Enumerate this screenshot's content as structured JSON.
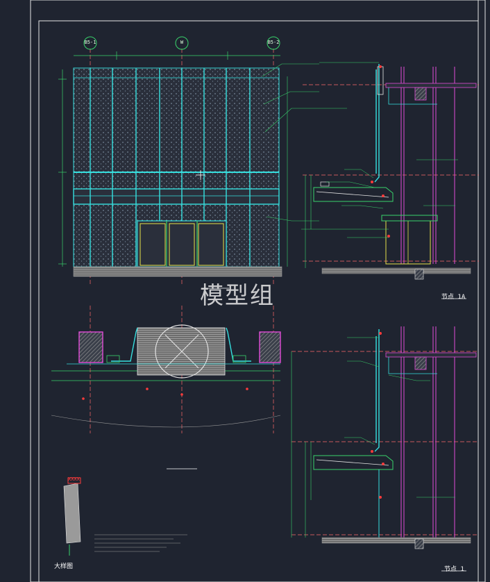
{
  "watermark": "模型组",
  "grid_bubbles": {
    "left": "B5-1",
    "mid": "W",
    "right": "B5-2"
  },
  "section_label_1": "节点 1A",
  "section_label_2": "节点 1",
  "bottom_caption": "大样图",
  "small_tag": "XXXX",
  "colors": {
    "background": "#1f2430",
    "frame": "#e6e6e6",
    "structure_cyan": "#36e0e0",
    "dimension_green": "#39d36b",
    "accent_magenta": "#e24bd8",
    "hatch_gray": "#9a9a9a",
    "red_tag": "#ff3b3b",
    "yellow": "#e6e04a"
  }
}
